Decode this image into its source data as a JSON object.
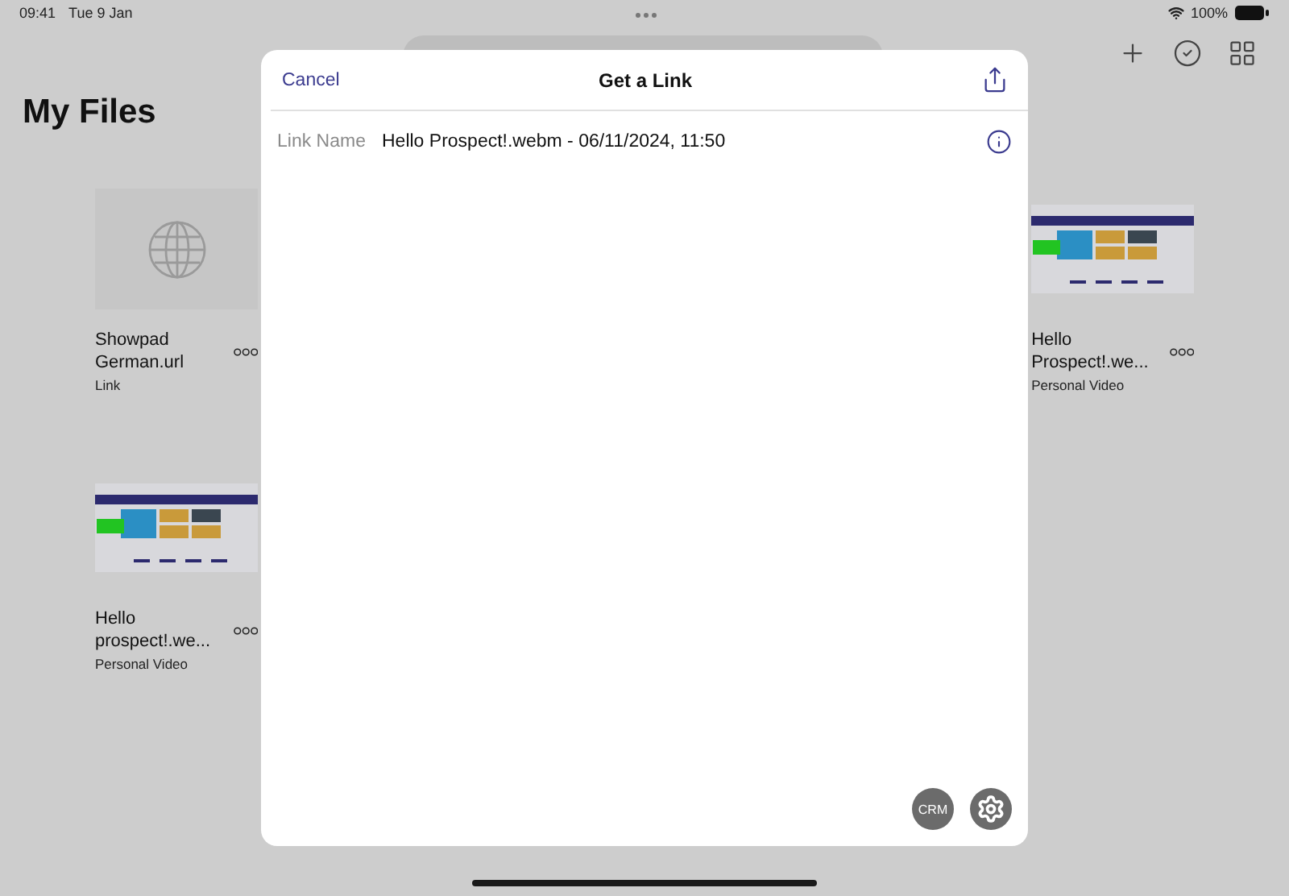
{
  "status_bar": {
    "time": "09:41",
    "date": "Tue 9 Jan",
    "battery": "100%"
  },
  "page": {
    "title": "My Files"
  },
  "files": [
    {
      "name": "Showpad German.url",
      "type": "Link",
      "kind": "link"
    },
    {
      "name": "Hello Prospect!.we...",
      "type": "Personal Video",
      "kind": "video"
    },
    {
      "name": "Hello prospect!.we...",
      "type": "Personal Video",
      "kind": "video"
    }
  ],
  "dialog": {
    "title": "Get a Link",
    "cancel": "Cancel",
    "field_label": "Link Name",
    "field_value": "Hello Prospect!.webm - 06/11/2024, 11:50",
    "crm_button": "CRM"
  }
}
